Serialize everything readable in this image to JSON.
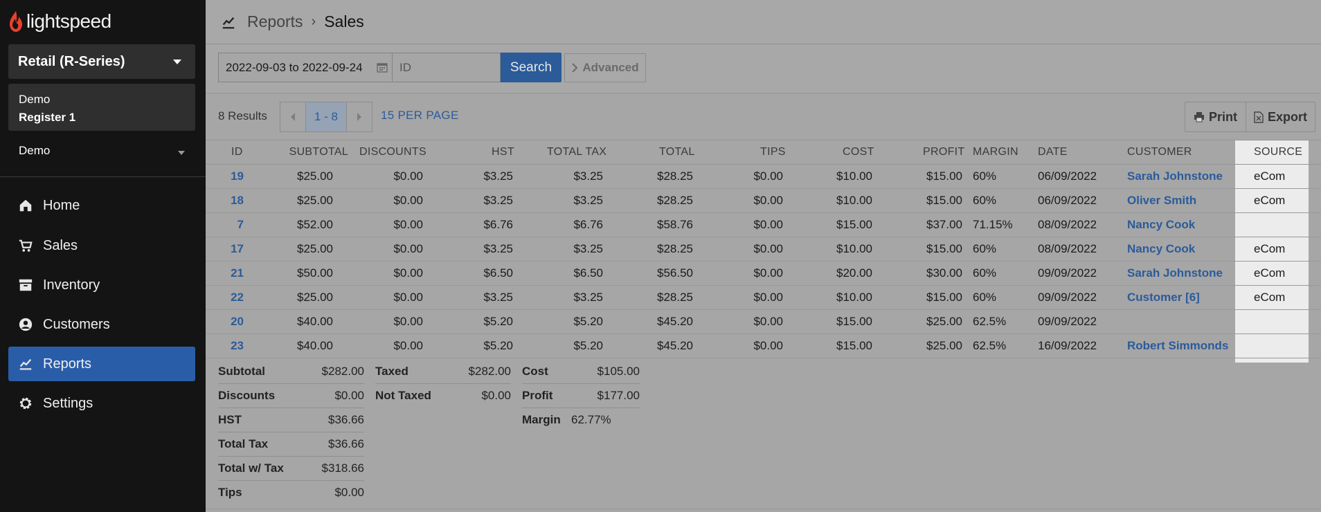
{
  "brand": {
    "name": "lightspeed"
  },
  "sidebar": {
    "product": "Retail (R-Series)",
    "shop": "Demo",
    "register": "Register 1",
    "user": "Demo",
    "items": [
      {
        "label": "Home",
        "icon": "home-icon"
      },
      {
        "label": "Sales",
        "icon": "sales-icon"
      },
      {
        "label": "Inventory",
        "icon": "inventory-icon"
      },
      {
        "label": "Customers",
        "icon": "customers-icon"
      },
      {
        "label": "Reports",
        "icon": "reports-icon",
        "active": true
      },
      {
        "label": "Settings",
        "icon": "settings-icon"
      }
    ]
  },
  "breadcrumb": {
    "parent": "Reports",
    "current": "Sales"
  },
  "filters": {
    "date_range": "2022-09-03 to 2022-09-24",
    "id_placeholder": "ID",
    "search_label": "Search",
    "advanced_label": "Advanced"
  },
  "results": {
    "count_text": "8 Results",
    "page_range": "1 - 8",
    "per_page": "15 PER PAGE",
    "print_label": "Print",
    "export_label": "Export"
  },
  "table": {
    "headers": {
      "id": "ID",
      "subtotal": "SUBTOTAL",
      "discounts": "DISCOUNTS",
      "hst": "HST",
      "total_tax": "TOTAL TAX",
      "total": "TOTAL",
      "tips": "TIPS",
      "cost": "COST",
      "profit": "PROFIT",
      "margin": "MARGIN",
      "date": "DATE",
      "customer": "CUSTOMER",
      "source": "SOURCE"
    },
    "rows": [
      {
        "id": "19",
        "subtotal": "$25.00",
        "discounts": "$0.00",
        "hst": "$3.25",
        "total_tax": "$3.25",
        "total": "$28.25",
        "tips": "$0.00",
        "cost": "$10.00",
        "profit": "$15.00",
        "margin": "60%",
        "date": "06/09/2022",
        "customer": "Sarah Johnstone",
        "source": "eCom"
      },
      {
        "id": "18",
        "subtotal": "$25.00",
        "discounts": "$0.00",
        "hst": "$3.25",
        "total_tax": "$3.25",
        "total": "$28.25",
        "tips": "$0.00",
        "cost": "$10.00",
        "profit": "$15.00",
        "margin": "60%",
        "date": "06/09/2022",
        "customer": "Oliver Smith",
        "source": "eCom"
      },
      {
        "id": "7",
        "subtotal": "$52.00",
        "discounts": "$0.00",
        "hst": "$6.76",
        "total_tax": "$6.76",
        "total": "$58.76",
        "tips": "$0.00",
        "cost": "$15.00",
        "profit": "$37.00",
        "margin": "71.15%",
        "date": "08/09/2022",
        "customer": "Nancy Cook",
        "source": ""
      },
      {
        "id": "17",
        "subtotal": "$25.00",
        "discounts": "$0.00",
        "hst": "$3.25",
        "total_tax": "$3.25",
        "total": "$28.25",
        "tips": "$0.00",
        "cost": "$10.00",
        "profit": "$15.00",
        "margin": "60%",
        "date": "08/09/2022",
        "customer": "Nancy Cook",
        "source": "eCom"
      },
      {
        "id": "21",
        "subtotal": "$50.00",
        "discounts": "$0.00",
        "hst": "$6.50",
        "total_tax": "$6.50",
        "total": "$56.50",
        "tips": "$0.00",
        "cost": "$20.00",
        "profit": "$30.00",
        "margin": "60%",
        "date": "09/09/2022",
        "customer": "Sarah Johnstone",
        "source": "eCom"
      },
      {
        "id": "22",
        "subtotal": "$25.00",
        "discounts": "$0.00",
        "hst": "$3.25",
        "total_tax": "$3.25",
        "total": "$28.25",
        "tips": "$0.00",
        "cost": "$10.00",
        "profit": "$15.00",
        "margin": "60%",
        "date": "09/09/2022",
        "customer": "Customer [6]",
        "source": "eCom"
      },
      {
        "id": "20",
        "subtotal": "$40.00",
        "discounts": "$0.00",
        "hst": "$5.20",
        "total_tax": "$5.20",
        "total": "$45.20",
        "tips": "$0.00",
        "cost": "$15.00",
        "profit": "$25.00",
        "margin": "62.5%",
        "date": "09/09/2022",
        "customer": "",
        "source": ""
      },
      {
        "id": "23",
        "subtotal": "$40.00",
        "discounts": "$0.00",
        "hst": "$5.20",
        "total_tax": "$5.20",
        "total": "$45.20",
        "tips": "$0.00",
        "cost": "$15.00",
        "profit": "$25.00",
        "margin": "62.5%",
        "date": "16/09/2022",
        "customer": "Robert Simmonds",
        "source": ""
      }
    ]
  },
  "summary": {
    "col1": [
      {
        "label": "Subtotal",
        "value": "$282.00"
      },
      {
        "label": "Discounts",
        "value": "$0.00"
      },
      {
        "label": "HST",
        "value": "$36.66"
      },
      {
        "label": "Total Tax",
        "value": "$36.66"
      },
      {
        "label": "Total w/ Tax",
        "value": "$318.66"
      },
      {
        "label": "Tips",
        "value": "$0.00"
      }
    ],
    "col2": [
      {
        "label": "Taxed",
        "value": "$282.00"
      },
      {
        "label": "Not Taxed",
        "value": "$0.00"
      }
    ],
    "col3": [
      {
        "label": "Cost",
        "value": "$105.00"
      },
      {
        "label": "Profit",
        "value": "$177.00"
      },
      {
        "label": "Margin",
        "value": "62.77%"
      }
    ]
  },
  "colors": {
    "accent": "#2b5b99",
    "sidebar_bg": "#141414",
    "active_nav": "#2a5da8",
    "brand_red": "#e8412c"
  }
}
